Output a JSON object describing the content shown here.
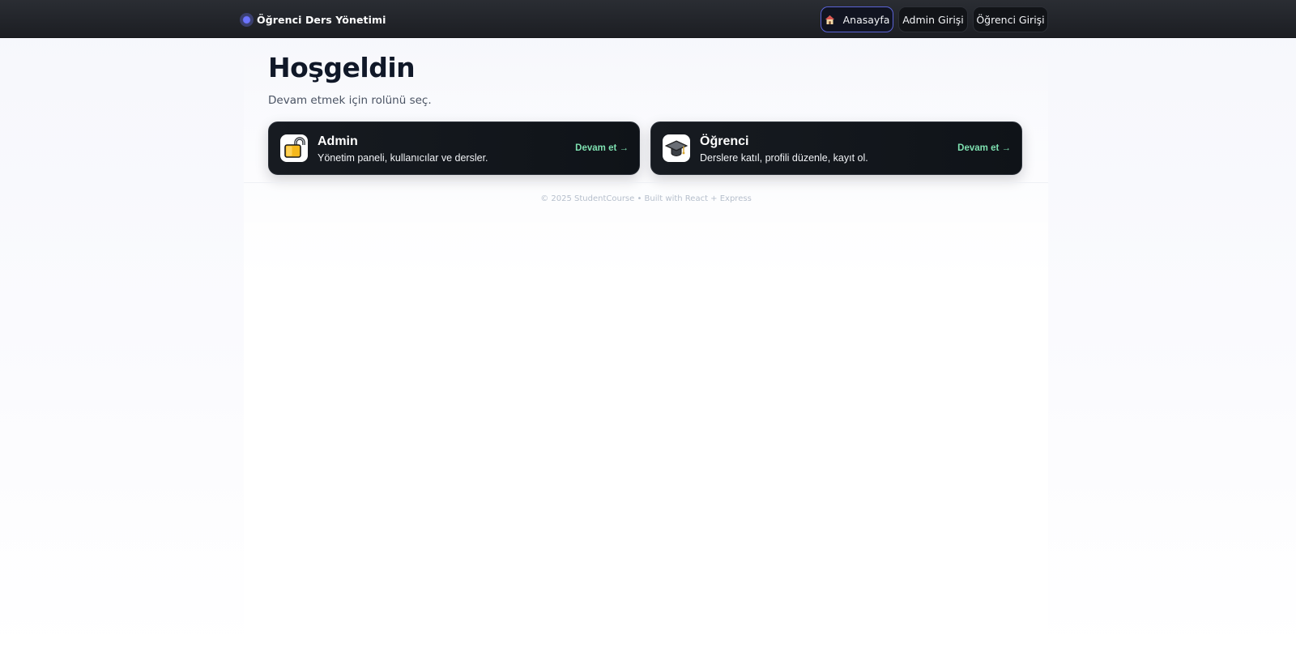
{
  "header": {
    "brand": "Öğrenci Ders Yönetimi",
    "nav": {
      "home": "Anasayfa",
      "admin_login": "Admin Girişi",
      "student_login": "Öğrenci Girişi"
    }
  },
  "main": {
    "title": "Hoşgeldin",
    "subtitle": "Devam etmek için rolünü seç.",
    "cards": [
      {
        "icon": "lock-icon",
        "title": "Admin",
        "description": "Yönetim paneli, kullanıcılar ve dersler.",
        "cta": "Devam et →"
      },
      {
        "icon": "graduation-cap-icon",
        "title": "Öğrenci",
        "description": "Derslere katıl, profili düzenle, kayıt ol.",
        "cta": "Devam et →"
      }
    ]
  },
  "footer": {
    "text": "© 2025 StudentCourse • Built with React + Express"
  },
  "colors": {
    "accent": "#5a63d6",
    "cta": "#7ee0b0",
    "header_bg": "#1c1e23",
    "title": "#101828"
  }
}
